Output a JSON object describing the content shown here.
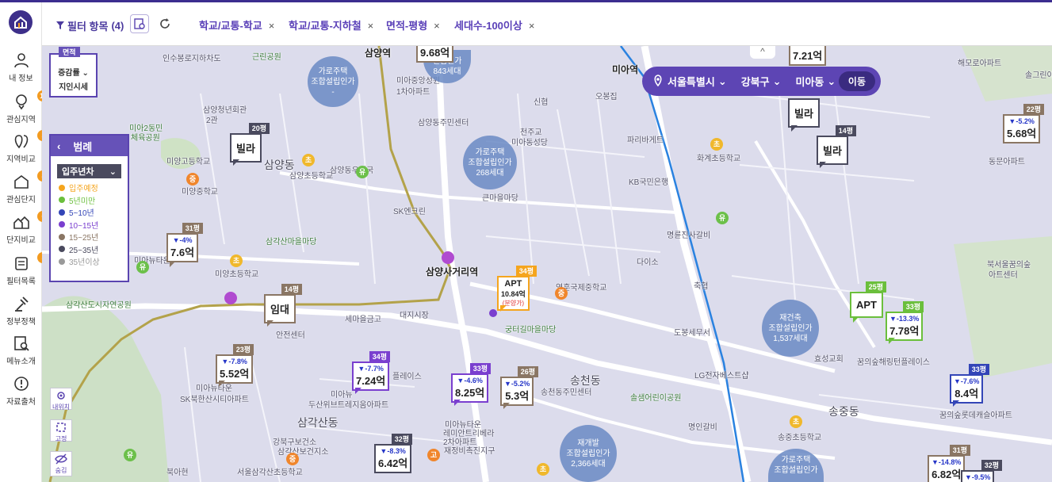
{
  "sidebar": {
    "items": [
      {
        "label": "내 정보",
        "badge": ""
      },
      {
        "label": "관심지역",
        "badge": "10"
      },
      {
        "label": "지역비교",
        "badge": "5"
      },
      {
        "label": "관심단지",
        "badge": "8"
      },
      {
        "label": "단지비교",
        "badge": "6"
      },
      {
        "label": "필터목록",
        "badge": "5"
      },
      {
        "label": "정부정책",
        "badge": ""
      },
      {
        "label": "메뉴소개",
        "badge": ""
      },
      {
        "label": "자료출처",
        "badge": ""
      }
    ]
  },
  "filterbar": {
    "title": "필터 항목",
    "count": "(4)",
    "chips": [
      "학교/교통-학교",
      "학교/교통-지하철",
      "면적-평형",
      "세대수-100이상"
    ],
    "close_glyph": "×"
  },
  "location": {
    "city": "서울특별시",
    "district": "강북구",
    "dong": "미아동",
    "go_label": "이동"
  },
  "area_box": {
    "tag": "면적",
    "line1": "증감률",
    "line2": "지인시세"
  },
  "legend": {
    "title": "범례",
    "selector": "입주년차",
    "items": [
      {
        "label": "입주예정",
        "color": "#f5a51e"
      },
      {
        "label": "5년미만",
        "color": "#6bbf3c"
      },
      {
        "label": "5~10년",
        "color": "#3345b7"
      },
      {
        "label": "10~15년",
        "color": "#7a3fcf"
      },
      {
        "label": "15~25년",
        "color": "#8a7664"
      },
      {
        "label": "25~35년",
        "color": "#4a4a5e"
      },
      {
        "label": "35년이상",
        "color": "#9a9a9a"
      }
    ]
  },
  "tools": [
    {
      "label": "내위치"
    },
    {
      "label": "고정"
    },
    {
      "label": "숨김"
    }
  ],
  "places": [
    "인수봉로지하차도",
    "근린공원",
    "삼양역",
    "미아중앙성원",
    "미아동부센트레빌",
    "1차아파트",
    "삼양동주민센터",
    "신협",
    "오봉집",
    "삼양청년회관",
    "2관",
    "미아2동민",
    "체육공원",
    "미양고등학교",
    "삼양동",
    "삼양초등학교",
    "삼양동우체국",
    "천주교",
    "미아동성당",
    "파리바게트",
    "화계초등학교",
    "미양중학교",
    "KB국민은행",
    "SK엔크린",
    "큰마을마당",
    "삼각산마을마당",
    "명륜진사갈비",
    "미아뉴타운",
    "미양초등학교",
    "삼양사거리역",
    "다이소",
    "축협",
    "삼각산도시자연공원",
    "솔샘",
    "세마을금고",
    "대지시장",
    "궁터길마을마당",
    "영훈국제중학교",
    "도봉세무서",
    "안전센터",
    "미아뉴타운",
    "SK북한산시티아파트",
    "미아뉴",
    "두산위브트레지움아파트",
    "플레이스",
    "삼각산동",
    "송천동",
    "송천동주민센터",
    "LG전자베스트샵",
    "솔샘어린이공원",
    "명인갈비",
    "송중초등학교",
    "송중동",
    "효성교회",
    "꿈의숲해링턴플레이스",
    "꿈의숲롯데캐슬아파트",
    "미아뉴타운",
    "레미안트리베라",
    "2차아파트",
    "재정비촉진지구",
    "강북구보건소",
    "삼각산보건지소",
    "서울삼각산초등학교",
    "북아현",
    "해모로아파트",
    "솔그린아",
    "동문아파트",
    "북서울꿈의숲",
    "아트센터",
    "미아역"
  ],
  "circles": [
    {
      "l1": "가로주택",
      "l2": "조합설립인가",
      "l3": "-"
    },
    {
      "l1": "가로주택",
      "l2": "조합설립인가",
      "l3": "268세대"
    },
    {
      "l1": "재건축",
      "l2": "조합설립인가",
      "l3": "1,537세대"
    },
    {
      "l1": "재개발",
      "l2": "조합설립인가",
      "l3": "2,366세대"
    },
    {
      "l1": "가로주택",
      "l2": "조합설립인가",
      "l3": ""
    },
    {
      "l1": "",
      "l2": "설립인가",
      "l3": "843세대"
    }
  ],
  "markers": [
    {
      "pyeong": "",
      "change": "",
      "price": "9.68억"
    },
    {
      "pyeong": "",
      "change": "",
      "price": "7.21억"
    },
    {
      "pyeong": "20평",
      "change": "",
      "price": "빌라"
    },
    {
      "pyeong": "",
      "change": "",
      "price": "빌라"
    },
    {
      "pyeong": "14평",
      "change": "",
      "price": "빌라"
    },
    {
      "pyeong": "22평",
      "change": "▼-5.2%",
      "price": "5.68억"
    },
    {
      "pyeong": "31평",
      "change": "▼-4%",
      "price": "7.6억"
    },
    {
      "pyeong": "14평",
      "change": "",
      "price": "임대"
    },
    {
      "pyeong": "34평",
      "change": "",
      "price": "APT",
      "extra": "10.84억",
      "sub": "(분양가)"
    },
    {
      "pyeong": "25평",
      "change": "",
      "price": "APT"
    },
    {
      "pyeong": "33평",
      "change": "▼-13.3%",
      "price": "7.78억"
    },
    {
      "pyeong": "23평",
      "change": "▼-7.8%",
      "price": "5.52억"
    },
    {
      "pyeong": "34평",
      "change": "▼-7.7%",
      "price": "7.24억"
    },
    {
      "pyeong": "33평",
      "change": "▼-4.6%",
      "price": "8.25억"
    },
    {
      "pyeong": "26평",
      "change": "▼-5.2%",
      "price": "5.3억"
    },
    {
      "pyeong": "33평",
      "change": "▼-7.6%",
      "price": "8.4억"
    },
    {
      "pyeong": "32평",
      "change": "▼-8.3%",
      "price": "6.42억"
    },
    {
      "pyeong": "31평",
      "change": "▼-14.8%",
      "price": "6.82억"
    },
    {
      "pyeong": "32평",
      "change": "▼-9.5%",
      "price": ""
    }
  ],
  "poi_labels": {
    "school": "초",
    "middle": "중",
    "kinder": "유",
    "high": "고"
  }
}
